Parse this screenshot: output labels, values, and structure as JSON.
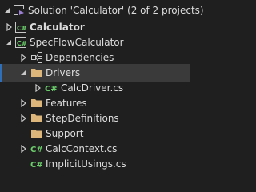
{
  "tree": {
    "solution": {
      "label": "Solution 'Calculator' (2 of 2 projects)",
      "icon": "solution-icon"
    },
    "projects": [
      {
        "label": "Calculator",
        "icon": "csharp-project-icon"
      },
      {
        "label": "SpecFlowCalculator",
        "icon": "csharp-project-icon"
      }
    ],
    "items": [
      {
        "label": "Dependencies",
        "icon": "dependencies-icon"
      },
      {
        "label": "Drivers",
        "icon": "folder-icon",
        "selected": true
      },
      {
        "label": "CalcDriver.cs",
        "icon": "csharp-file-icon"
      },
      {
        "label": "Features",
        "icon": "folder-icon"
      },
      {
        "label": "StepDefinitions",
        "icon": "folder-icon"
      },
      {
        "label": "Support",
        "icon": "folder-icon"
      },
      {
        "label": "CalcContext.cs",
        "icon": "csharp-file-icon"
      },
      {
        "label": "ImplicitUsings.cs",
        "icon": "csharp-file-icon"
      }
    ]
  },
  "colors": {
    "background": "#1f1f1f",
    "selection": "#3a3a3a",
    "folder": "#dcb67a",
    "csharp": "#6ccf6c",
    "text": "#dcdcdc"
  }
}
